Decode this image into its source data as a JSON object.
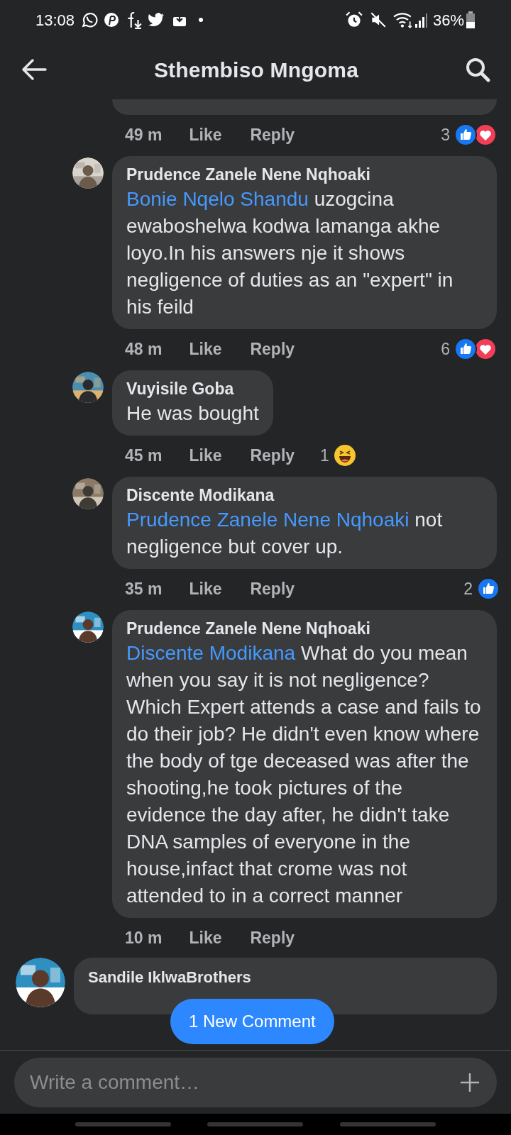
{
  "status_bar": {
    "time": "13:08",
    "battery": "36%"
  },
  "header": {
    "title": "Sthembiso Mngoma"
  },
  "replies": [
    {
      "time": "49 m",
      "like": "Like",
      "reply": "Reply",
      "reaction_count": "3",
      "reactions": [
        {
          "kind": "like"
        },
        {
          "kind": "love"
        }
      ]
    },
    {
      "name": "Prudence Zanele Nene Nqhoaki",
      "mention": "Bonie Nqelo Shandu",
      "text": "uzogcina ewaboshelwa kodwa lamanga akhe loyo.In his answers nje it shows negligence of duties as an \"expert\" in his feild",
      "time": "48 m",
      "like": "Like",
      "reply": "Reply",
      "reaction_count": "6",
      "reactions": [
        {
          "kind": "like"
        },
        {
          "kind": "love"
        }
      ]
    },
    {
      "name": "Vuyisile Goba",
      "text": "He was bought",
      "time": "45 m",
      "like": "Like",
      "reply": "Reply",
      "reaction_count": "1",
      "reactions": [
        {
          "kind": "haha"
        }
      ]
    },
    {
      "name": "Discente Modikana",
      "mention": "Prudence Zanele Nene Nqhoaki",
      "text": "not negligence but cover up.",
      "time": "35 m",
      "like": "Like",
      "reply": "Reply",
      "reaction_count": "2",
      "reactions": [
        {
          "kind": "like"
        }
      ]
    },
    {
      "name": "Prudence Zanele Nene Nqhoaki",
      "mention": "Discente Modikana",
      "text": "What do you mean when you say it is not negligence? Which Expert attends a case and fails to do their job? He didn't even know where the body of tge deceased was after the shooting,he took pictures of the evidence the day after, he didn't take DNA samples of everyone in the house,infact that crome was not attended to in a correct manner",
      "time": "10 m",
      "like": "Like",
      "reply": "Reply"
    }
  ],
  "comments": [
    {
      "name": "Sandile IklwaBrothers"
    }
  ],
  "new_comment_pill": "1 New Comment",
  "composer": {
    "placeholder": "Write a comment…"
  }
}
